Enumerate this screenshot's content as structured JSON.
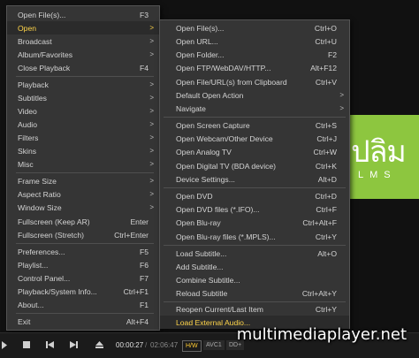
{
  "logo": {
    "glyphs": "ปลิม",
    "subtitle": "LMS"
  },
  "main_menu": {
    "items": [
      {
        "label": "Open File(s)...",
        "shortcut": "F3"
      },
      {
        "label": "Open",
        "arrow": true
      },
      {
        "label": "Broadcast",
        "arrow": true
      },
      {
        "label": "Album/Favorites",
        "arrow": true
      },
      {
        "label": "Close Playback",
        "shortcut": "F4"
      },
      {
        "label": "Playback",
        "arrow": true
      },
      {
        "label": "Subtitles",
        "arrow": true
      },
      {
        "label": "Video",
        "arrow": true
      },
      {
        "label": "Audio",
        "arrow": true
      },
      {
        "label": "Filters",
        "arrow": true
      },
      {
        "label": "Skins",
        "arrow": true
      },
      {
        "label": "Misc",
        "arrow": true
      },
      {
        "label": "Frame Size",
        "arrow": true
      },
      {
        "label": "Aspect Ratio",
        "arrow": true
      },
      {
        "label": "Window Size",
        "arrow": true
      },
      {
        "label": "Fullscreen (Keep AR)",
        "shortcut": "Enter"
      },
      {
        "label": "Fullscreen (Stretch)",
        "shortcut": "Ctrl+Enter"
      },
      {
        "label": "Preferences...",
        "shortcut": "F5"
      },
      {
        "label": "Playlist...",
        "shortcut": "F6"
      },
      {
        "label": "Control Panel...",
        "shortcut": "F7"
      },
      {
        "label": "Playback/System Info...",
        "shortcut": "Ctrl+F1"
      },
      {
        "label": "About...",
        "shortcut": "F1"
      },
      {
        "label": "Exit",
        "shortcut": "Alt+F4"
      }
    ]
  },
  "open_submenu": {
    "items": [
      {
        "label": "Open File(s)...",
        "shortcut": "Ctrl+O"
      },
      {
        "label": "Open URL...",
        "shortcut": "Ctrl+U"
      },
      {
        "label": "Open Folder...",
        "shortcut": "F2"
      },
      {
        "label": "Open FTP/WebDAV/HTTP...",
        "shortcut": "Alt+F12"
      },
      {
        "label": "Open File/URL(s) from Clipboard",
        "shortcut": "Ctrl+V"
      },
      {
        "label": "Default Open Action",
        "arrow": true
      },
      {
        "label": "Navigate",
        "arrow": true
      },
      {
        "label": "Open Screen Capture",
        "shortcut": "Ctrl+S"
      },
      {
        "label": "Open Webcam/Other Device",
        "shortcut": "Ctrl+J"
      },
      {
        "label": "Open Analog TV",
        "shortcut": "Ctrl+W"
      },
      {
        "label": "Open Digital TV (BDA device)",
        "shortcut": "Ctrl+K"
      },
      {
        "label": "Device Settings...",
        "shortcut": "Alt+D"
      },
      {
        "label": "Open DVD",
        "shortcut": "Ctrl+D"
      },
      {
        "label": "Open DVD files (*.IFO)...",
        "shortcut": "Ctrl+F"
      },
      {
        "label": "Open Blu-ray",
        "shortcut": "Ctrl+Alt+F"
      },
      {
        "label": "Open Blu-ray files (*.MPLS)...",
        "shortcut": "Ctrl+Y"
      },
      {
        "label": "Load Subtitle...",
        "shortcut": "Alt+O"
      },
      {
        "label": "Add Subtitle...",
        "shortcut": ""
      },
      {
        "label": "Combine Subtitle...",
        "shortcut": ""
      },
      {
        "label": "Reload Subtitle",
        "shortcut": "Ctrl+Alt+Y"
      },
      {
        "label": "Reopen Current/Last Item",
        "shortcut": "Ctrl+Y"
      },
      {
        "label": "Load External Audio...",
        "shortcut": ""
      }
    ]
  },
  "controls": {
    "time_current": "00:00:27",
    "time_separator": "/",
    "time_total": "02:06:47",
    "badge_hw": "H/W",
    "badge_codec": "AVC1",
    "badge_audio": "DD+"
  },
  "watermark": "multimediaplayer.net",
  "colors": {
    "highlight": "#ffd54a",
    "menu_bg": "#353535",
    "logo_green": "#8dc63f"
  },
  "icons": [
    "play-icon",
    "stop-icon",
    "previous-icon",
    "next-icon",
    "eject-icon",
    "speaker-icon"
  ]
}
